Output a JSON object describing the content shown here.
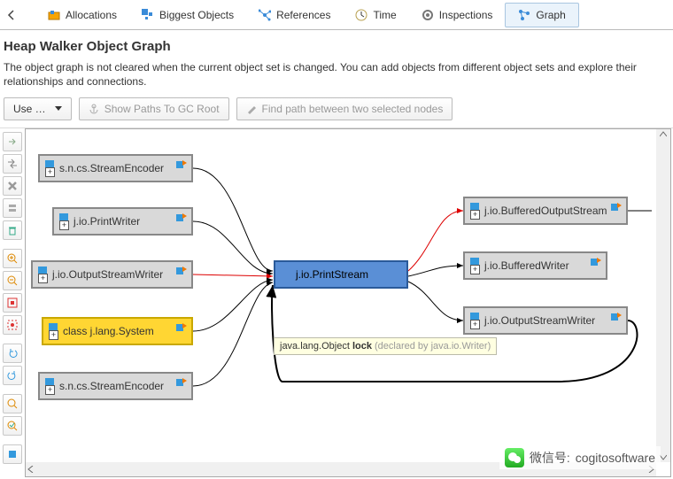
{
  "tabs": [
    {
      "label": "Allocations"
    },
    {
      "label": "Biggest Objects"
    },
    {
      "label": "References"
    },
    {
      "label": "Time"
    },
    {
      "label": "Inspections"
    },
    {
      "label": "Graph"
    }
  ],
  "header": {
    "title": "Heap Walker Object Graph",
    "desc": "The object graph is not cleared when the current object set is changed. You can add objects from different object sets and explore their relationships and connections."
  },
  "buttons": {
    "use": "Use …",
    "paths": "Show Paths To GC Root",
    "findpath": "Find path between two selected nodes"
  },
  "nodes": {
    "n1": "s.n.cs.StreamEncoder",
    "n2": "j.io.PrintWriter",
    "n3": "j.io.OutputStreamWriter",
    "n4": "class j.lang.System",
    "n5": "s.n.cs.StreamEncoder",
    "center": "j.io.PrintStream",
    "r1": "j.io.BufferedOutputStream",
    "r2": "j.io.BufferedWriter",
    "r3": "j.io.OutputStreamWriter"
  },
  "tooltip": {
    "main": "java.lang.Object ",
    "bold": "lock",
    "faded": " (declared by java.io.Writer)"
  },
  "footer": {
    "label": "微信号: ",
    "value": "cogitosoftware"
  },
  "sidebar_icons": [
    "arrow-right",
    "arrows",
    "x",
    "stack",
    "trash",
    "zoom-in",
    "zoom-out",
    "fit",
    "fit-selection",
    "undo",
    "redo",
    "search",
    "search2",
    "marker"
  ]
}
